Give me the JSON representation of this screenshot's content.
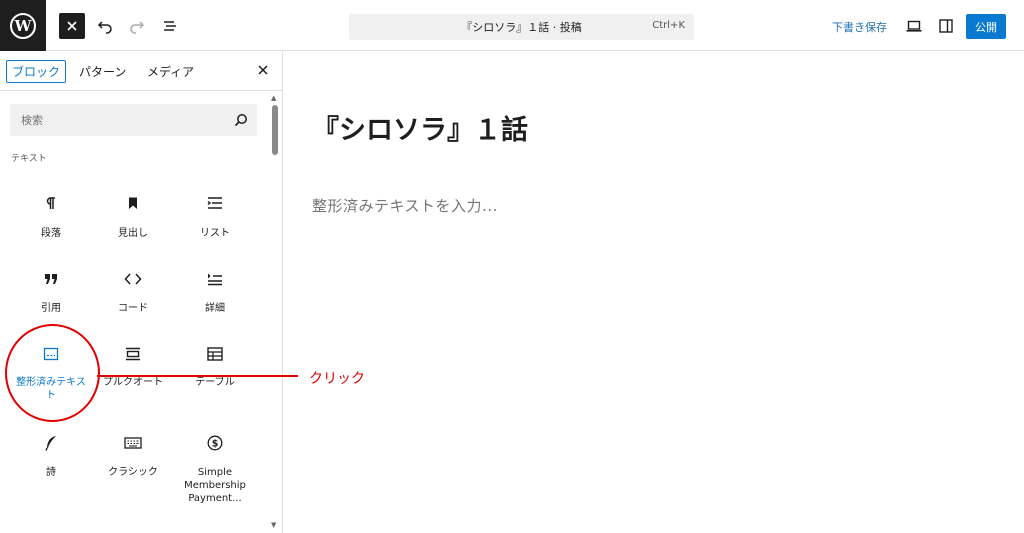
{
  "toolbar": {
    "document_title": "『シロソラ』１話 · 投稿",
    "shortcut": "Ctrl+K",
    "save_draft_label": "下書き保存",
    "publish_label": "公開"
  },
  "inserter": {
    "tabs": [
      {
        "label": "ブロック",
        "active": true
      },
      {
        "label": "パターン",
        "active": false
      },
      {
        "label": "メディア",
        "active": false
      }
    ],
    "search_placeholder": "検索",
    "section_title": "テキスト",
    "blocks": [
      {
        "label": "段落",
        "icon": "paragraph-icon"
      },
      {
        "label": "見出し",
        "icon": "bookmark-icon"
      },
      {
        "label": "リスト",
        "icon": "list-icon"
      },
      {
        "label": "引用",
        "icon": "quote-icon"
      },
      {
        "label": "コード",
        "icon": "code-icon"
      },
      {
        "label": "詳細",
        "icon": "details-icon"
      },
      {
        "label": "整形済みテキスト",
        "icon": "preformatted-icon",
        "selected": true
      },
      {
        "label": "プルクオート",
        "icon": "pullquote-icon"
      },
      {
        "label": "テーブル",
        "icon": "table-icon"
      },
      {
        "label": "詩",
        "icon": "feather-icon"
      },
      {
        "label": "クラシック",
        "icon": "keyboard-icon"
      },
      {
        "label": "Simple Membership Payment...",
        "icon": "dollar-icon"
      }
    ]
  },
  "editor": {
    "post_title": "『シロソラ』１話",
    "block_placeholder": "整形済みテキストを入力..."
  },
  "annotation": {
    "label": "クリック",
    "color": "#e00000"
  },
  "colors": {
    "accent": "#0a7ad0",
    "dark": "#1e1e1e"
  }
}
